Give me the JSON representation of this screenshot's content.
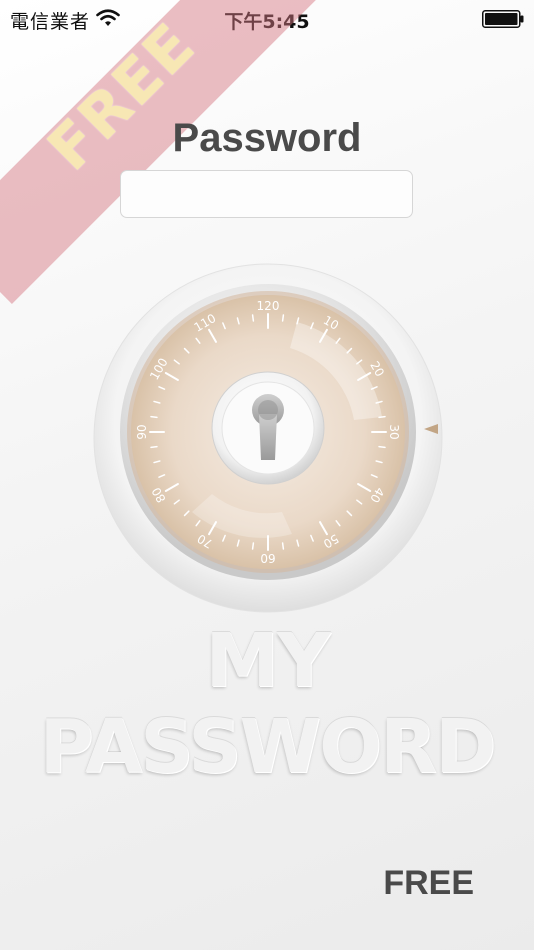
{
  "status_bar": {
    "carrier": "電信業者",
    "time": "下午5:45",
    "wifi_icon": "wifi-icon",
    "battery_icon": "battery-icon"
  },
  "ribbon": {
    "text": "FREE",
    "color": "#d5787f"
  },
  "password": {
    "label": "Password",
    "value": "",
    "placeholder": ""
  },
  "dial": {
    "icon": "combination-lock-dial",
    "labels": [
      "120",
      "10",
      "20",
      "30",
      "40",
      "50",
      "60",
      "70",
      "80",
      "90",
      "100",
      "110"
    ],
    "keyhole_icon": "keyhole-icon",
    "pointer_icon": "triangle-pointer-icon"
  },
  "brand": {
    "logo_text": "MY PASSWORD"
  },
  "footer": {
    "free_label": "FREE"
  }
}
